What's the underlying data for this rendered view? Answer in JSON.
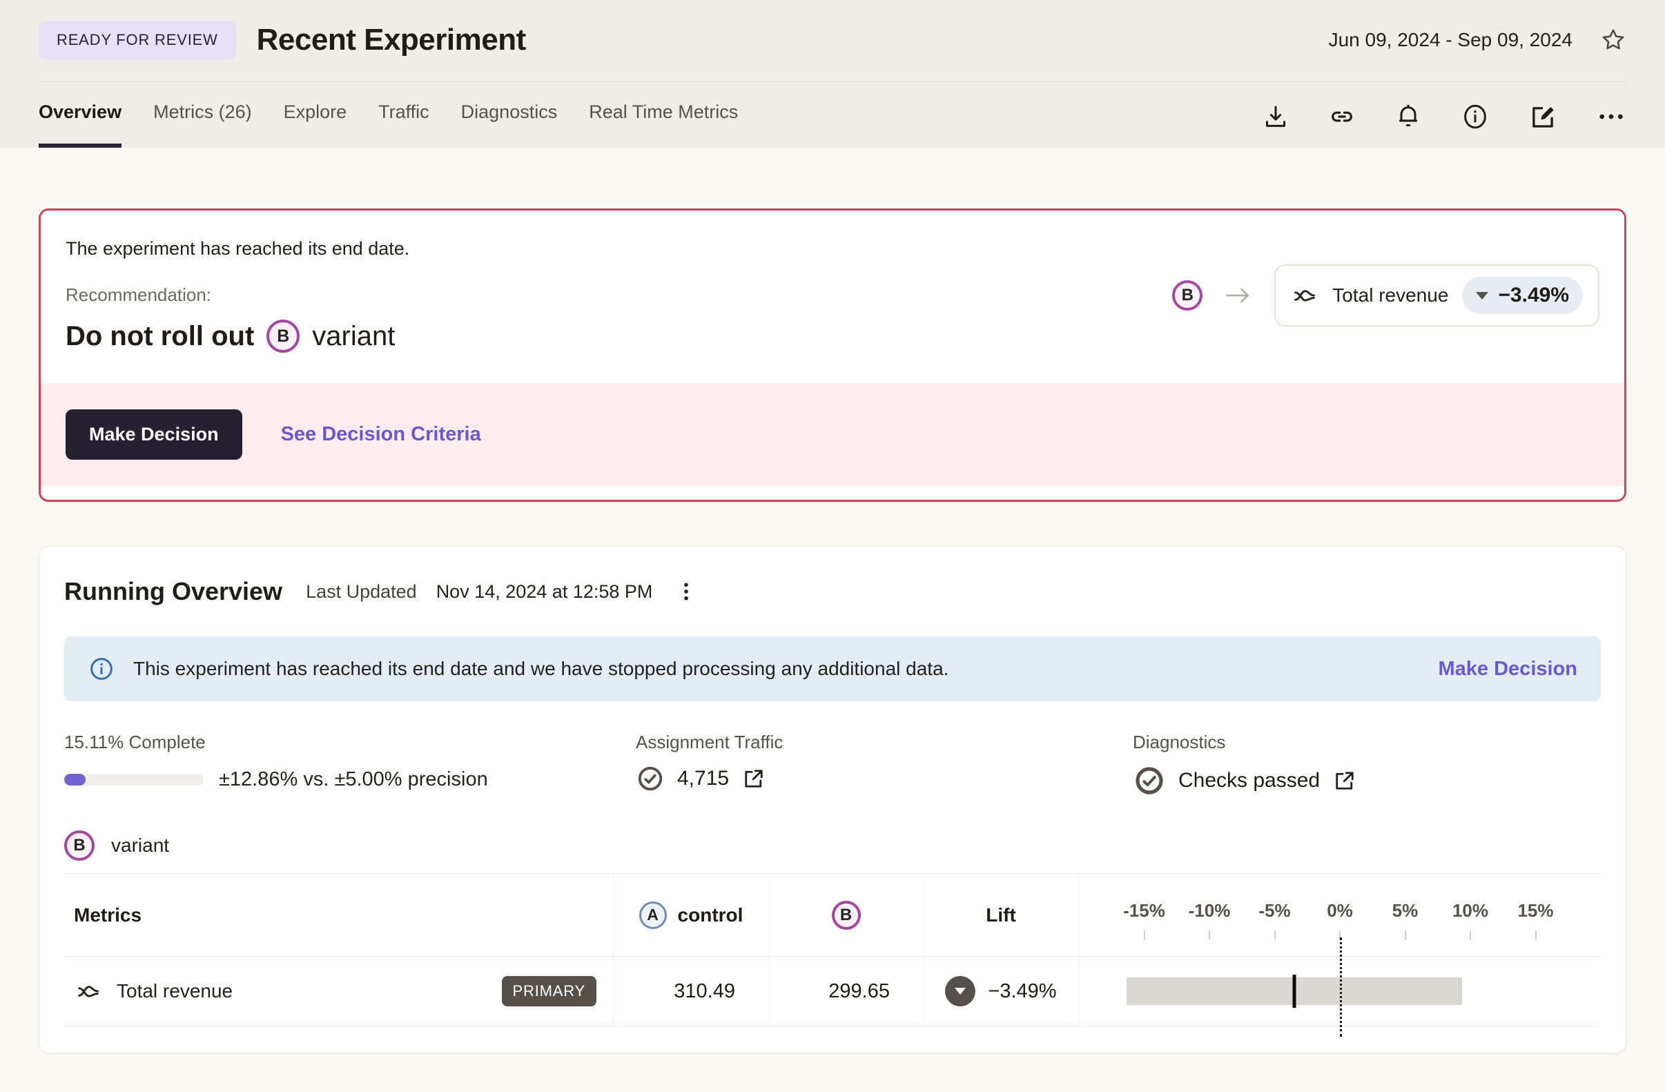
{
  "header": {
    "status_badge": "READY FOR REVIEW",
    "title": "Recent Experiment",
    "date_range": "Jun 09, 2024 - Sep 09, 2024",
    "tabs": [
      {
        "label": "Overview",
        "active": true
      },
      {
        "label": "Metrics (26)",
        "active": false
      },
      {
        "label": "Explore",
        "active": false
      },
      {
        "label": "Traffic",
        "active": false
      },
      {
        "label": "Diagnostics",
        "active": false
      },
      {
        "label": "Real Time Metrics",
        "active": false
      }
    ],
    "action_icons": [
      "download-icon",
      "link-icon",
      "bell-icon",
      "info-icon",
      "edit-icon",
      "more-icon"
    ]
  },
  "alert": {
    "message": "The experiment has reached its end date.",
    "recommendation_label": "Recommendation:",
    "recommendation_action": "Do not roll out",
    "variant_badge": "B",
    "recommendation_suffix": "variant",
    "metric_pill": {
      "variant": "B",
      "metric": "Total revenue",
      "delta": "−3.49%"
    },
    "make_decision_label": "Make Decision",
    "see_criteria_label": "See Decision Criteria"
  },
  "overview": {
    "title": "Running Overview",
    "last_updated_label": "Last Updated",
    "last_updated": "Nov 14, 2024 at 12:58 PM",
    "banner": {
      "text": "This experiment has reached its end date and we have stopped processing any additional data.",
      "action": "Make Decision"
    },
    "progress": {
      "percent_label": "15.11% Complete",
      "percent": 15.11,
      "precision_text": "±12.86% vs. ±5.00% precision"
    },
    "assignment_traffic": {
      "label": "Assignment Traffic",
      "value": "4,715"
    },
    "diagnostics": {
      "label": "Diagnostics",
      "status": "Checks passed"
    },
    "variant": {
      "badge": "B",
      "label": "variant"
    }
  },
  "table": {
    "headers": {
      "metrics": "Metrics",
      "control_badge": "A",
      "control_label": "control",
      "variant_badge": "B",
      "lift": "Lift"
    },
    "rows": [
      {
        "metric": "Total revenue",
        "tag": "PRIMARY",
        "control": "310.49",
        "variant": "299.65",
        "lift": "−3.49%",
        "lift_direction": "down"
      }
    ]
  },
  "chart_data": {
    "type": "interval",
    "title": "Lift confidence interval",
    "axis_ticks": [
      "-15%",
      "-10%",
      "-5%",
      "0%",
      "5%",
      "10%",
      "15%"
    ],
    "axis_tick_values": [
      -15,
      -10,
      -5,
      0,
      5,
      10,
      15
    ],
    "axis_range": [
      -20,
      20
    ],
    "zero_line": 0,
    "rows": [
      {
        "metric": "Total revenue",
        "lift": -3.49,
        "ci_low": -16.35,
        "ci_high": 9.37
      }
    ]
  },
  "colors": {
    "alert_border": "#cd4359",
    "alert_footer_bg": "#fcecef",
    "accent_purple": "#6a57d2",
    "progress_fill": "#7164d0",
    "variant_b_ring": "#a4479f",
    "control_a_ring": "#6f8cba",
    "banner_bg": "#e4edf6",
    "badge_bg": "#e6e1f7",
    "dark_button": "#272030",
    "primary_tag_bg": "#575049",
    "ci_bar": "#d9d7d0"
  }
}
